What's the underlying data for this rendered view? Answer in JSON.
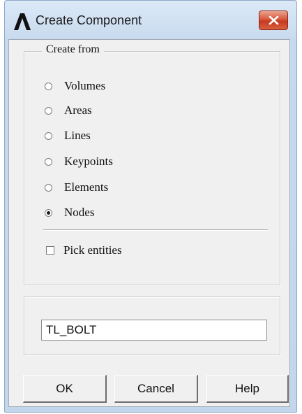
{
  "window": {
    "title": "Create Component"
  },
  "icons": {
    "app_logo": "ansys-logo-icon",
    "close": "close-icon"
  },
  "colors": {
    "close_button": "#d9573c",
    "title_gradient_top": "#dbe9f7",
    "dialog_background": "#f0f0f0"
  },
  "create_from": {
    "legend": "Create from",
    "options": [
      {
        "label": "Volumes",
        "selected": false
      },
      {
        "label": "Areas",
        "selected": false
      },
      {
        "label": "Lines",
        "selected": false
      },
      {
        "label": "Keypoints",
        "selected": false
      },
      {
        "label": "Elements",
        "selected": false
      },
      {
        "label": "Nodes",
        "selected": true
      }
    ],
    "pick_entities": {
      "label": "Pick entities",
      "checked": false
    }
  },
  "component_name": {
    "value": "TL_BOLT"
  },
  "buttons": {
    "ok": "OK",
    "cancel": "Cancel",
    "help": "Help"
  }
}
